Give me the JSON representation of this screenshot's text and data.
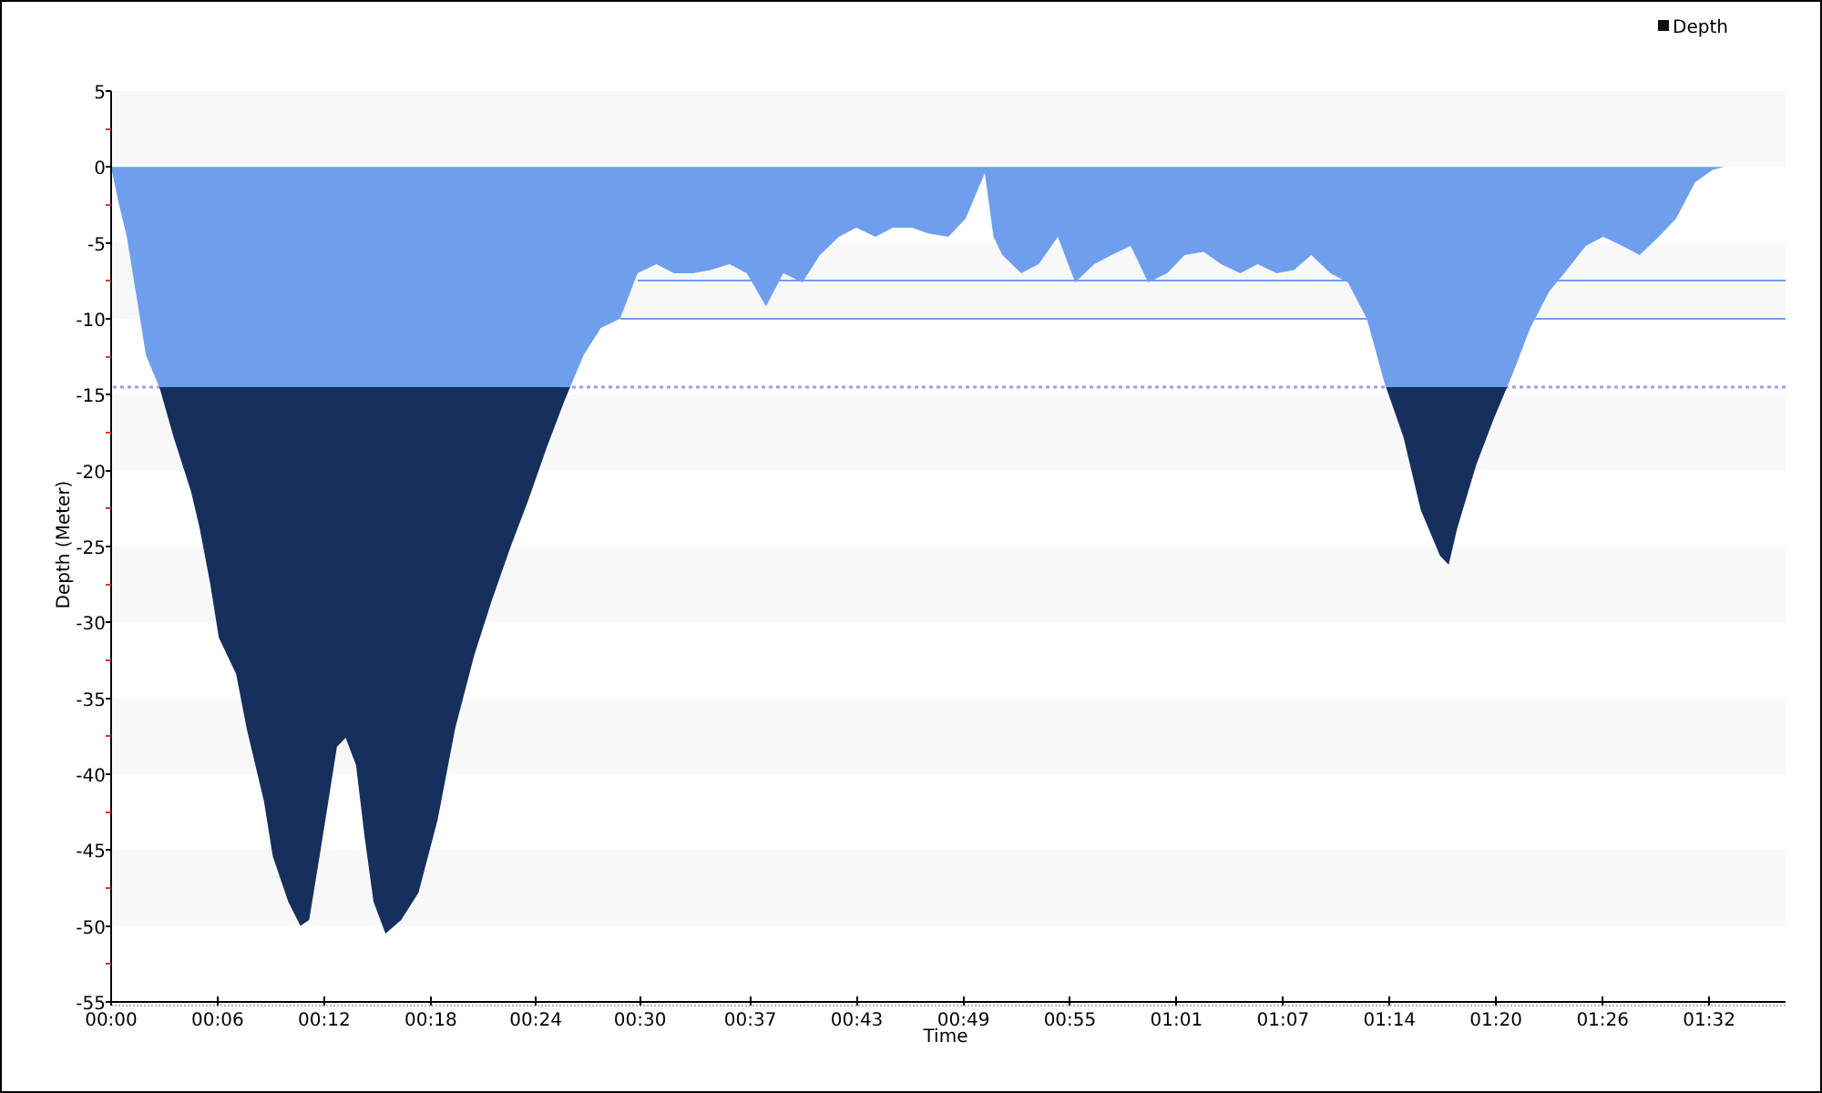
{
  "chart": {
    "chart_data": {
      "type": "area",
      "xlabel": "Time",
      "ylabel": "Depth (Meter)",
      "x": [
        0,
        0.4,
        0.9,
        1.5,
        2.0,
        2.8,
        3.6,
        4.1,
        4.6,
        5.1,
        5.7,
        6.2,
        7.2,
        7.8,
        8.8,
        9.3,
        10.2,
        10.9,
        11.4,
        12.0,
        12.5,
        13.0,
        13.5,
        14.1,
        14.6,
        15.1,
        15.8,
        16.7,
        17.7,
        18.8,
        19.8,
        20.9,
        21.4,
        21.9,
        23.0,
        24.0,
        25.1,
        26.1,
        27.2,
        28.2,
        29.3,
        30.3,
        31.4,
        32.4,
        33.5,
        34.5,
        35.6,
        36.6,
        37.7,
        38.7,
        39.8,
        40.8,
        41.9,
        42.9,
        44.0,
        45.0,
        46.1,
        47.1,
        48.2,
        49.2,
        50.3,
        50.8,
        51.3,
        52.4,
        53.4,
        54.5,
        55.5,
        56.6,
        57.6,
        58.7,
        59.7,
        60.8,
        61.8,
        62.9,
        63.9,
        65.0,
        66.0,
        67.1,
        68.1,
        69.1,
        70.2,
        71.2,
        72.3,
        73.3,
        74.4,
        75.4,
        76.5,
        77.0,
        77.5,
        78.6,
        79.6,
        80.7,
        81.7,
        82.8,
        83.8,
        84.9,
        85.9,
        87.0,
        88.0,
        89.1,
        90.1,
        91.2,
        92.2,
        92.8
      ],
      "series": [
        {
          "name": "Depth",
          "color": "#6f9fec",
          "values": [
            0,
            -2.2,
            -4.6,
            -8.8,
            -12.4,
            -14.6,
            -17.8,
            -19.6,
            -21.4,
            -23.8,
            -27.4,
            -31.0,
            -33.4,
            -37.0,
            -41.8,
            -45.4,
            -48.4,
            -50.0,
            -49.6,
            -45.4,
            -41.8,
            -38.2,
            -37.6,
            -39.4,
            -44.2,
            -48.4,
            -50.5,
            -49.6,
            -47.8,
            -43.0,
            -37.0,
            -32.2,
            -30.4,
            -28.6,
            -25.0,
            -22.0,
            -18.4,
            -15.4,
            -12.4,
            -10.6,
            -10.0,
            -7.0,
            -6.4,
            -7.0,
            -7.0,
            -6.8,
            -6.4,
            -7.0,
            -9.2,
            -7.0,
            -7.6,
            -5.8,
            -4.6,
            -4.0,
            -4.6,
            -4.0,
            -4.0,
            -4.4,
            -4.6,
            -3.4,
            -0.4,
            -4.6,
            -5.8,
            -7.0,
            -6.4,
            -4.6,
            -7.6,
            -6.4,
            -5.8,
            -5.2,
            -7.6,
            -7.0,
            -5.8,
            -5.6,
            -6.4,
            -7.0,
            -6.4,
            -7.0,
            -6.8,
            -5.8,
            -7.0,
            -7.6,
            -10.0,
            -14.2,
            -17.8,
            -22.6,
            -25.6,
            -26.2,
            -23.8,
            -19.6,
            -16.6,
            -13.6,
            -10.6,
            -8.2,
            -6.8,
            -5.2,
            -4.6,
            -5.2,
            -5.8,
            -4.6,
            -3.4,
            -1.0,
            -0.2,
            0
          ]
        }
      ],
      "xlim": [
        0,
        96.4
      ],
      "ylim": [
        -55,
        5
      ],
      "xticks": [
        {
          "value": 0,
          "label": "00:00"
        },
        {
          "value": 6.13,
          "label": "00:06"
        },
        {
          "value": 12.27,
          "label": "00:12"
        },
        {
          "value": 18.4,
          "label": "00:18"
        },
        {
          "value": 24.45,
          "label": "00:24"
        },
        {
          "value": 30.45,
          "label": "00:30"
        },
        {
          "value": 36.8,
          "label": "00:37"
        },
        {
          "value": 42.93,
          "label": "00:43"
        },
        {
          "value": 49.07,
          "label": "00:49"
        },
        {
          "value": 55.2,
          "label": "00:55"
        },
        {
          "value": 61.33,
          "label": "01:01"
        },
        {
          "value": 67.47,
          "label": "01:07"
        },
        {
          "value": 73.6,
          "label": "01:14"
        },
        {
          "value": 79.73,
          "label": "01:20"
        },
        {
          "value": 85.87,
          "label": "01:26"
        },
        {
          "value": 92,
          "label": "01:32"
        }
      ],
      "yticks": [
        5,
        0,
        -5,
        -10,
        -15,
        -20,
        -25,
        -30,
        -35,
        -40,
        -45,
        -50,
        -55
      ],
      "ref_lines": [
        {
          "axis": "y",
          "value": -14.5
        },
        {
          "axis": "y",
          "value": -7.5
        },
        {
          "axis": "y",
          "value": -10
        }
      ]
    }
  }
}
